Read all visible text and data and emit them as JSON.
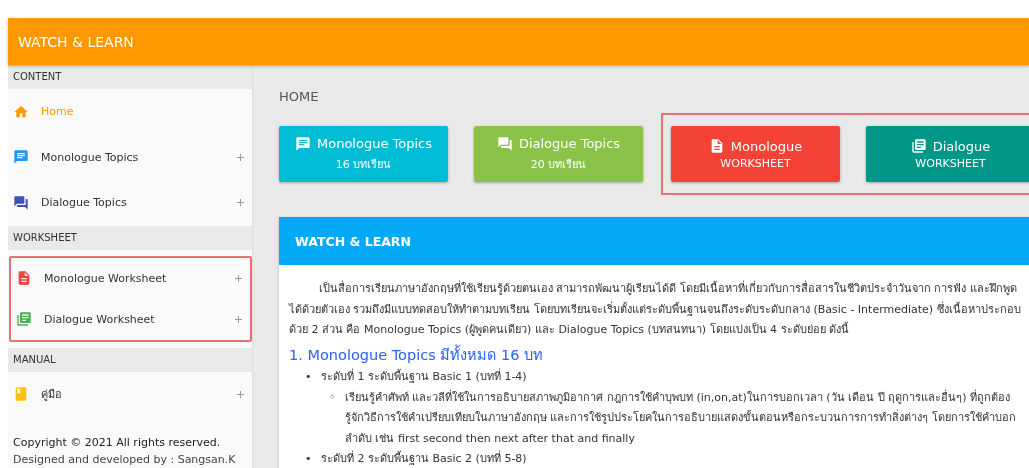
{
  "header": {
    "title": "WATCH & LEARN"
  },
  "sidebar": {
    "sections": [
      {
        "title": "CONTENT",
        "items": [
          {
            "label": "Home",
            "kind": "home",
            "color": "#ff9800",
            "selected": true,
            "expandable": false,
            "highlighted": false
          },
          {
            "label": "Monologue Topics",
            "kind": "chat",
            "color": "#2196f3",
            "selected": false,
            "expandable": true,
            "highlighted": false
          },
          {
            "label": "Dialogue Topics",
            "kind": "forum",
            "color": "#3f51b5",
            "selected": false,
            "expandable": true,
            "highlighted": false
          }
        ]
      },
      {
        "title": "WORKSHEET",
        "items": [
          {
            "label": "Monologue Worksheet",
            "kind": "doc",
            "color": "#f44336",
            "selected": false,
            "expandable": true,
            "highlighted": true
          },
          {
            "label": "Dialogue Worksheet",
            "kind": "library",
            "color": "#4caf50",
            "selected": false,
            "expandable": true,
            "highlighted": true
          }
        ]
      },
      {
        "title": "MANUAL",
        "items": [
          {
            "label": "คู่มือ",
            "kind": "book",
            "color": "#ffc107",
            "selected": false,
            "expandable": true,
            "highlighted": false
          }
        ]
      }
    ],
    "footer": [
      "Copyright © 2021 All rights reserved.",
      "Designed and developed by : Sangsan.K"
    ]
  },
  "main": {
    "breadcrumb": "HOME",
    "cards": [
      {
        "title": "Monologue Topics",
        "subtitle": "16 บทเรียน",
        "kind": "chat",
        "color": "#00bcd4",
        "highlighted": false
      },
      {
        "title": "Dialogue Topics",
        "subtitle": "20 บทเรียน",
        "kind": "forum",
        "color": "#8bc34a",
        "highlighted": false
      },
      {
        "title": "Monologue",
        "subtitle": "WORKSHEET",
        "kind": "doc",
        "color": "#f44336",
        "highlighted": true
      },
      {
        "title": "Dialogue",
        "subtitle": "WORKSHEET",
        "kind": "library",
        "color": "#009688",
        "highlighted": true
      }
    ],
    "panel": {
      "title": "WATCH & LEARN",
      "intro": "เป็นสื่อการเรียนภาษาอังกฤษที่ใช้เรียนรู้ด้วยตนเอง สามารถพัฒนาผู้เรียนได้ดี โดยมีเนื้อหาที่เกี่ยวกับการสื่อสารในชีวิตประจำวันจาก การฟัง และฝึกพูดได้ด้วยตัวเอง รวมถึงมีแบบทดสอบให้ทำตามบทเรียน โดยบทเรียนจะเริ่มตั้งแต่ระดับพื้นฐานจนถึงระดับระดับกลาง (Basic - Intermediate) ซึ่งเนื้อหาประกอบด้วย 2 ส่วน คือ Monologue Topics (ผู้พูดคนเดียว) และ Dialogue Topics (บทสนทนา) โดยแบ่งเป็น 4 ระดับย่อย ดังนี้",
      "heading": "1. Monologue Topics มีทั้งหมด 16 บท",
      "list": [
        {
          "marker": "•",
          "text": "ระดับที่ 1 ระดับพื้นฐาน Basic 1 (บทที่ 1-4)",
          "children": [
            {
              "marker": "◦",
              "text": "เรียนรู้คำศัพท์ และวลีที่ใช้ในการอธิบายสภาพภูมิอากาศ กฎการใช้คำบุพบท (in,on,at)ในการบอกเวลา (วัน เดือน ปี ฤดูการและอื่นๆ) ที่ถูกต้อง รู้จักวิธีการใช้คำเปรียบเทียบในภาษาอังกฤษ และการใช้รูปประโยคในการอธิบายแสดงขั้นตอนหรือกระบวนการการทำสิ่งต่างๆ โดยการใช้คำบอกลำดับ เช่น first second then next after that and finally"
            }
          ]
        },
        {
          "marker": "•",
          "text": "ระดับที่ 2 ระดับพื้นฐาน Basic 2 (บทที่ 5-8)"
        }
      ]
    }
  }
}
